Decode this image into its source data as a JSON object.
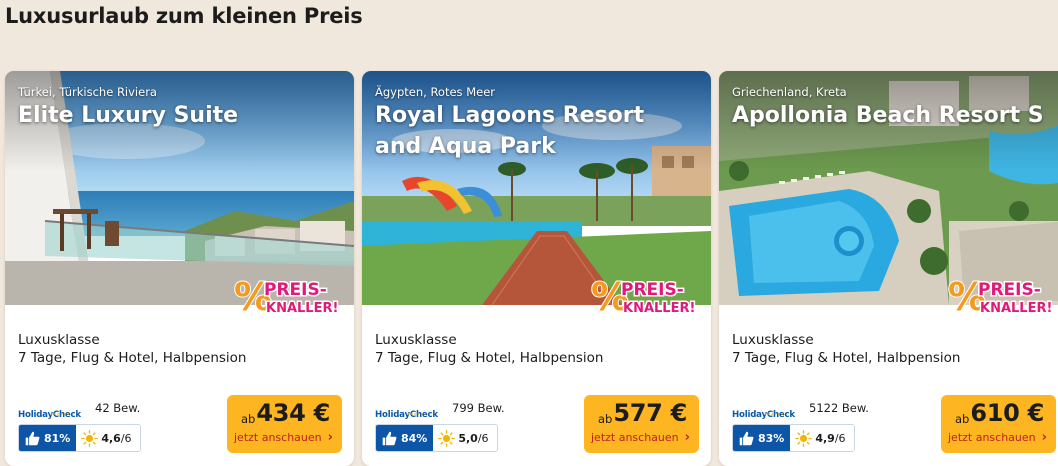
{
  "section": {
    "title": "Luxusurlaub zum kleinen Preis"
  },
  "badge": {
    "line1": "PREIS-",
    "line2": "KNALLER!"
  },
  "cards": [
    {
      "location": "Türkei, Türkische Riviera",
      "name": "Elite Luxury Suite",
      "category": "Luxusklasse",
      "package": "7 Tage, Flug & Hotel, Halbpension",
      "hc_logo": "HolidayCheck",
      "reviews": "42 Bew.",
      "recommendation": "81%",
      "sun_score": "4,6",
      "sun_max": "/6",
      "price_prefix": "ab",
      "price": "434 €",
      "cta": "jetzt anschauen"
    },
    {
      "location": "Ägypten, Rotes Meer",
      "name": "Royal Lagoons Resort and Aqua Park",
      "category": "Luxusklasse",
      "package": "7 Tage, Flug & Hotel, Halbpension",
      "hc_logo": "HolidayCheck",
      "reviews": "799 Bew.",
      "recommendation": "84%",
      "sun_score": "5,0",
      "sun_max": "/6",
      "price_prefix": "ab",
      "price": "577 €",
      "cta": "jetzt anschauen"
    },
    {
      "location": "Griechenland, Kreta",
      "name": "Apollonia Beach Resort S",
      "category": "Luxusklasse",
      "package": "7 Tage, Flug & Hotel, Halbpension",
      "hc_logo": "HolidayCheck",
      "reviews": "5122 Bew.",
      "recommendation": "83%",
      "sun_score": "4,9",
      "sun_max": "/6",
      "price_prefix": "ab",
      "price": "610 €",
      "cta": "jetzt anschauen"
    }
  ],
  "colors": {
    "page_background": "#f1e8dd",
    "price_button": "#fdb521",
    "cta_text": "#c0201f",
    "badge_orange": "#f39a1f",
    "badge_magenta": "#e0197a",
    "holidaycheck_blue": "#0d55a6"
  },
  "icons": {
    "thumbs": "thumbs-up-icon",
    "sun": "sun-icon",
    "chevron": "chevron-right-icon",
    "percent": "percent-icon"
  }
}
